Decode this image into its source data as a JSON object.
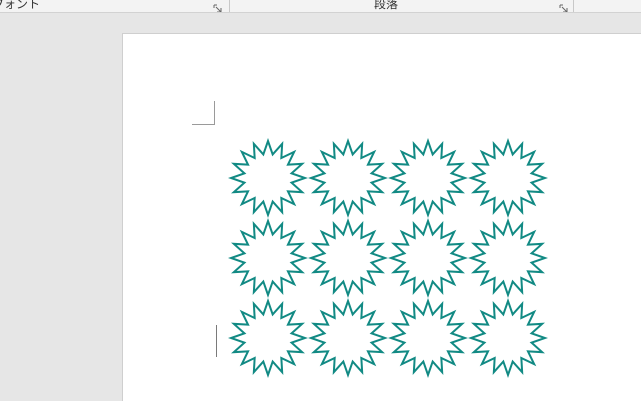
{
  "ribbon": {
    "font_group_label": "フォント",
    "paragraph_group_label": "段落"
  },
  "colors": {
    "star_stroke": "#128a84",
    "page": "#ffffff",
    "workspace": "#e6e6e6"
  },
  "document": {
    "shape": "star-16-point",
    "rows": 3,
    "columns": 4,
    "outlined": true
  }
}
